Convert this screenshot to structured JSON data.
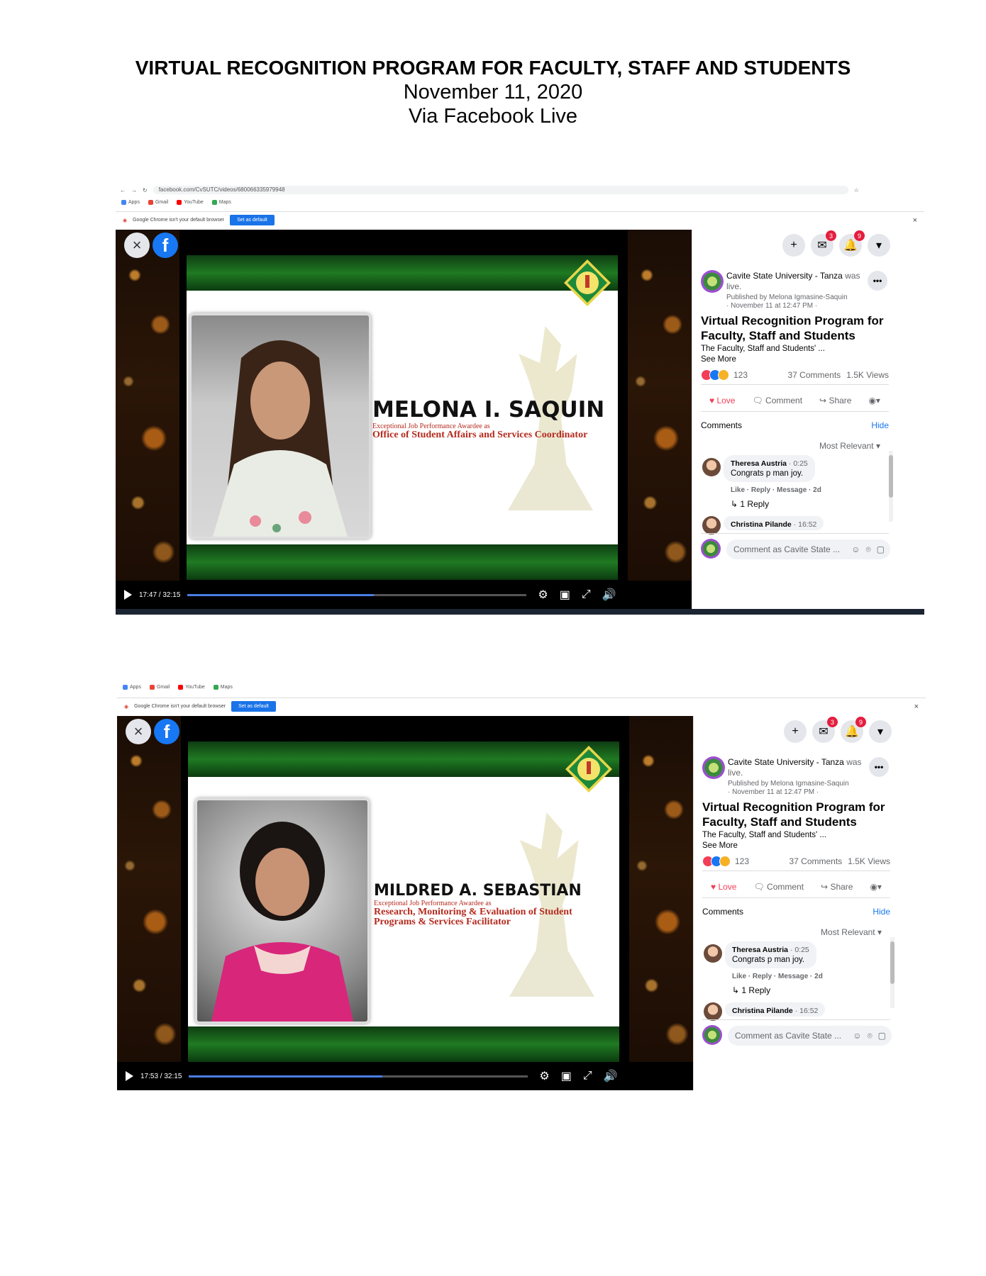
{
  "header": {
    "title": "VIRTUAL RECOGNITION PROGRAM FOR FACULTY, STAFF AND STUDENTS",
    "date": "November 11, 2020",
    "via": "Via Facebook Live"
  },
  "browser": {
    "url": "facebook.com/CvSUTC/videos/680066335979948",
    "bookmarks": [
      "Apps",
      "Gmail",
      "YouTube",
      "Maps"
    ],
    "infobar_text": "Google Chrome isn't your default browser",
    "infobar_button": "Set as default",
    "infobar_close": "×"
  },
  "facebook": {
    "page_name": "Cavite State University - Tanza",
    "was_live": "was live.",
    "published_by": "Published by Melona Igmasine-Saquin",
    "posted": "· November 11 at 12:47 PM ·",
    "video_title": "Virtual Recognition Program for Faculty, Staff and Students",
    "description": "The Faculty, Staff and Students' ...",
    "see_more": "See More",
    "reaction_count": "123",
    "comments_count": "37 Comments",
    "views_count": "1.5K Views",
    "love_label": "Love",
    "comment_label": "Comment",
    "share_label": "Share",
    "comments_heading": "Comments",
    "hide_label": "Hide",
    "sort_label": "Most Relevant",
    "messenger_badge": "3",
    "notifications_badge": "9",
    "comment1": {
      "author": "Theresa Austria",
      "time": "· 0:25",
      "text": "Congrats p man joy.",
      "links": "Like · Reply · Message · 2d",
      "replies": "1 Reply"
    },
    "comment2": {
      "author": "Christina Pilande",
      "time": "· 16:52"
    },
    "composer_placeholder": "Comment as Cavite State ...",
    "colors": {
      "blue": "#1877f2",
      "love": "#f33e58",
      "badge": "#e41e3f"
    }
  },
  "slides": [
    {
      "awardee_name": "MELONA I. SAQUIN",
      "award_label": "Exceptional Job Performance Awardee as",
      "position_lines": [
        "Office of Student Affairs and Services Coordinator"
      ],
      "time": "17:47 / 32:15",
      "progress": 0.55
    },
    {
      "awardee_name": "MILDRED A. SEBASTIAN",
      "award_label": "Exceptional Job Performance Awardee as",
      "position_lines": [
        "Research, Monitoring & Evaluation of Student",
        "Programs & Services Facilitator"
      ],
      "time": "17:53 / 32:15",
      "progress": 0.57
    }
  ]
}
